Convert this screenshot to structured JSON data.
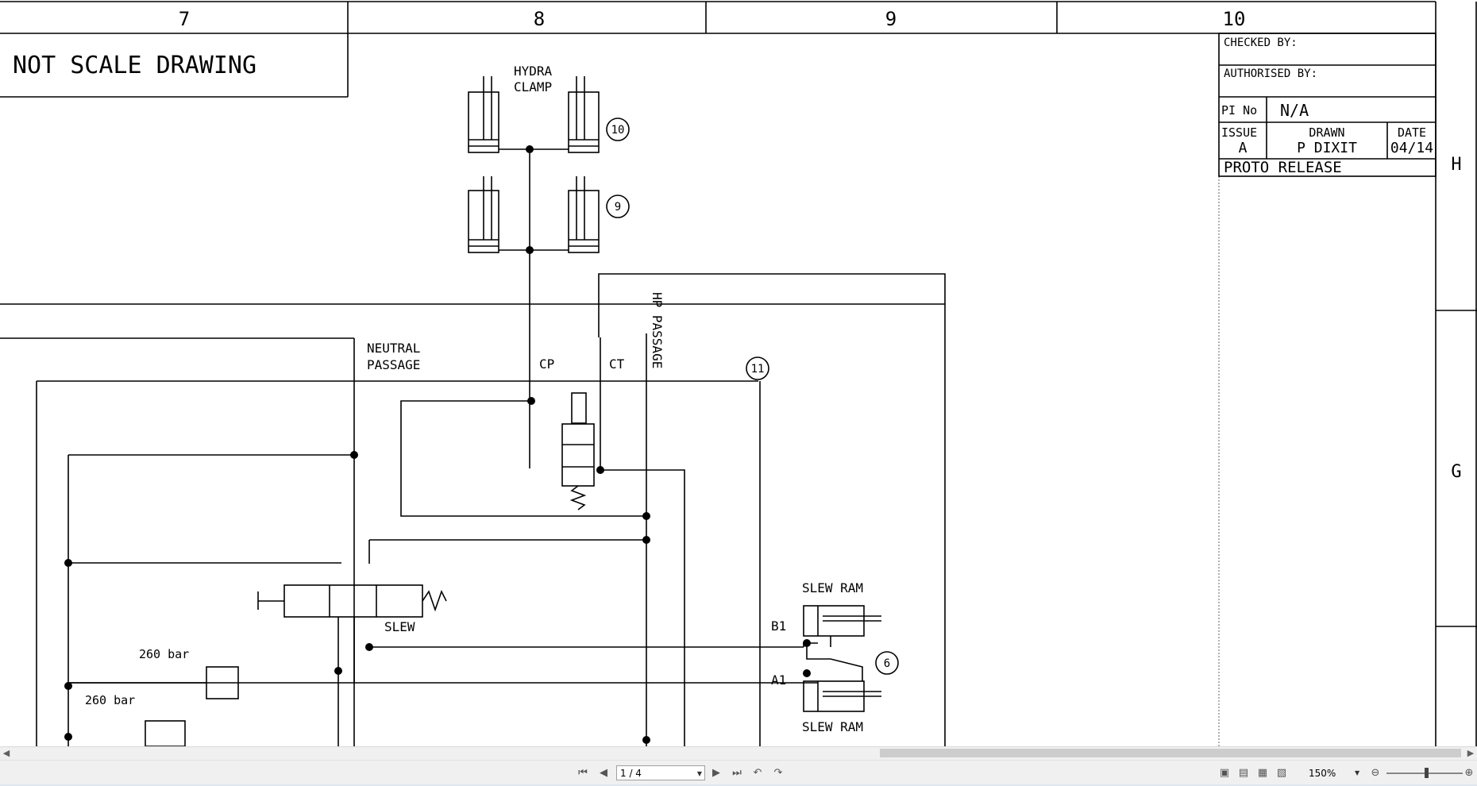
{
  "border": {
    "columns": [
      "7",
      "8",
      "9",
      "10"
    ],
    "rows": [
      "H",
      "G"
    ]
  },
  "note": "NOT SCALE DRAWING",
  "title_block": {
    "checked_by": "CHECKED BY:",
    "authorised_by": "AUTHORISED BY:",
    "pi_label": "PI No",
    "pi_value": "N/A",
    "issue_label": "ISSUE",
    "issue_value": "A",
    "drawn_label": "DRAWN",
    "drawn_value": "P DIXIT",
    "date_label": "DATE",
    "date_value": "04/14",
    "status": "PROTO RELEASE"
  },
  "labels": {
    "hydra_line1": "HYDRA",
    "hydra_line2": "CLAMP",
    "neutral_line1": "NEUTRAL",
    "neutral_line2": "PASSAGE",
    "cp": "CP",
    "ct": "CT",
    "hp_passage": "HP PASSAGE",
    "slew": "SLEW",
    "slew_ram_top": "SLEW RAM",
    "slew_ram_bottom": "SLEW RAM",
    "b1": "B1",
    "a1": "A1",
    "bar_upper": "260 bar",
    "bar_lower": "260 bar"
  },
  "callouts": [
    "10",
    "9",
    "11",
    "6"
  ],
  "viewer": {
    "page_value": "1 / 4",
    "zoom_value": "150%"
  },
  "colors": {
    "lines": "#000000",
    "toolbar_bg": "#f0f0f0"
  }
}
